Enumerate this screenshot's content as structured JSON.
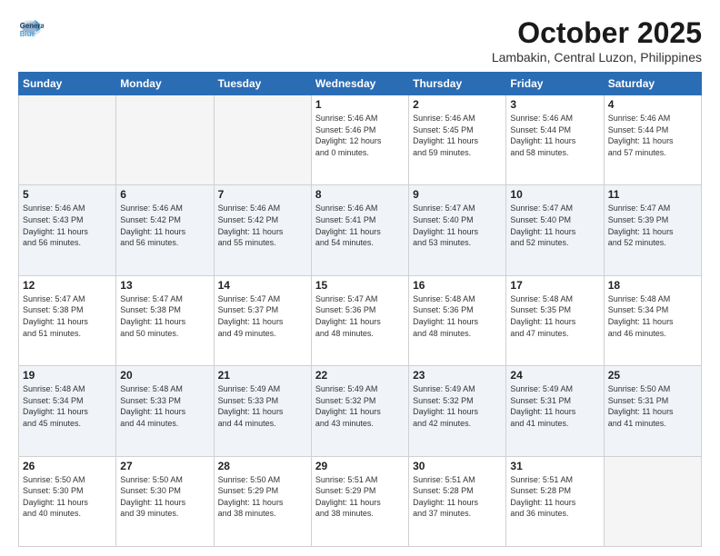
{
  "logo": {
    "line1": "General",
    "line2": "Blue"
  },
  "title": "October 2025",
  "location": "Lambakin, Central Luzon, Philippines",
  "days_header": [
    "Sunday",
    "Monday",
    "Tuesday",
    "Wednesday",
    "Thursday",
    "Friday",
    "Saturday"
  ],
  "weeks": [
    [
      {
        "day": "",
        "info": ""
      },
      {
        "day": "",
        "info": ""
      },
      {
        "day": "",
        "info": ""
      },
      {
        "day": "1",
        "info": "Sunrise: 5:46 AM\nSunset: 5:46 PM\nDaylight: 12 hours\nand 0 minutes."
      },
      {
        "day": "2",
        "info": "Sunrise: 5:46 AM\nSunset: 5:45 PM\nDaylight: 11 hours\nand 59 minutes."
      },
      {
        "day": "3",
        "info": "Sunrise: 5:46 AM\nSunset: 5:44 PM\nDaylight: 11 hours\nand 58 minutes."
      },
      {
        "day": "4",
        "info": "Sunrise: 5:46 AM\nSunset: 5:44 PM\nDaylight: 11 hours\nand 57 minutes."
      }
    ],
    [
      {
        "day": "5",
        "info": "Sunrise: 5:46 AM\nSunset: 5:43 PM\nDaylight: 11 hours\nand 56 minutes."
      },
      {
        "day": "6",
        "info": "Sunrise: 5:46 AM\nSunset: 5:42 PM\nDaylight: 11 hours\nand 56 minutes."
      },
      {
        "day": "7",
        "info": "Sunrise: 5:46 AM\nSunset: 5:42 PM\nDaylight: 11 hours\nand 55 minutes."
      },
      {
        "day": "8",
        "info": "Sunrise: 5:46 AM\nSunset: 5:41 PM\nDaylight: 11 hours\nand 54 minutes."
      },
      {
        "day": "9",
        "info": "Sunrise: 5:47 AM\nSunset: 5:40 PM\nDaylight: 11 hours\nand 53 minutes."
      },
      {
        "day": "10",
        "info": "Sunrise: 5:47 AM\nSunset: 5:40 PM\nDaylight: 11 hours\nand 52 minutes."
      },
      {
        "day": "11",
        "info": "Sunrise: 5:47 AM\nSunset: 5:39 PM\nDaylight: 11 hours\nand 52 minutes."
      }
    ],
    [
      {
        "day": "12",
        "info": "Sunrise: 5:47 AM\nSunset: 5:38 PM\nDaylight: 11 hours\nand 51 minutes."
      },
      {
        "day": "13",
        "info": "Sunrise: 5:47 AM\nSunset: 5:38 PM\nDaylight: 11 hours\nand 50 minutes."
      },
      {
        "day": "14",
        "info": "Sunrise: 5:47 AM\nSunset: 5:37 PM\nDaylight: 11 hours\nand 49 minutes."
      },
      {
        "day": "15",
        "info": "Sunrise: 5:47 AM\nSunset: 5:36 PM\nDaylight: 11 hours\nand 48 minutes."
      },
      {
        "day": "16",
        "info": "Sunrise: 5:48 AM\nSunset: 5:36 PM\nDaylight: 11 hours\nand 48 minutes."
      },
      {
        "day": "17",
        "info": "Sunrise: 5:48 AM\nSunset: 5:35 PM\nDaylight: 11 hours\nand 47 minutes."
      },
      {
        "day": "18",
        "info": "Sunrise: 5:48 AM\nSunset: 5:34 PM\nDaylight: 11 hours\nand 46 minutes."
      }
    ],
    [
      {
        "day": "19",
        "info": "Sunrise: 5:48 AM\nSunset: 5:34 PM\nDaylight: 11 hours\nand 45 minutes."
      },
      {
        "day": "20",
        "info": "Sunrise: 5:48 AM\nSunset: 5:33 PM\nDaylight: 11 hours\nand 44 minutes."
      },
      {
        "day": "21",
        "info": "Sunrise: 5:49 AM\nSunset: 5:33 PM\nDaylight: 11 hours\nand 44 minutes."
      },
      {
        "day": "22",
        "info": "Sunrise: 5:49 AM\nSunset: 5:32 PM\nDaylight: 11 hours\nand 43 minutes."
      },
      {
        "day": "23",
        "info": "Sunrise: 5:49 AM\nSunset: 5:32 PM\nDaylight: 11 hours\nand 42 minutes."
      },
      {
        "day": "24",
        "info": "Sunrise: 5:49 AM\nSunset: 5:31 PM\nDaylight: 11 hours\nand 41 minutes."
      },
      {
        "day": "25",
        "info": "Sunrise: 5:50 AM\nSunset: 5:31 PM\nDaylight: 11 hours\nand 41 minutes."
      }
    ],
    [
      {
        "day": "26",
        "info": "Sunrise: 5:50 AM\nSunset: 5:30 PM\nDaylight: 11 hours\nand 40 minutes."
      },
      {
        "day": "27",
        "info": "Sunrise: 5:50 AM\nSunset: 5:30 PM\nDaylight: 11 hours\nand 39 minutes."
      },
      {
        "day": "28",
        "info": "Sunrise: 5:50 AM\nSunset: 5:29 PM\nDaylight: 11 hours\nand 38 minutes."
      },
      {
        "day": "29",
        "info": "Sunrise: 5:51 AM\nSunset: 5:29 PM\nDaylight: 11 hours\nand 38 minutes."
      },
      {
        "day": "30",
        "info": "Sunrise: 5:51 AM\nSunset: 5:28 PM\nDaylight: 11 hours\nand 37 minutes."
      },
      {
        "day": "31",
        "info": "Sunrise: 5:51 AM\nSunset: 5:28 PM\nDaylight: 11 hours\nand 36 minutes."
      },
      {
        "day": "",
        "info": ""
      }
    ]
  ]
}
